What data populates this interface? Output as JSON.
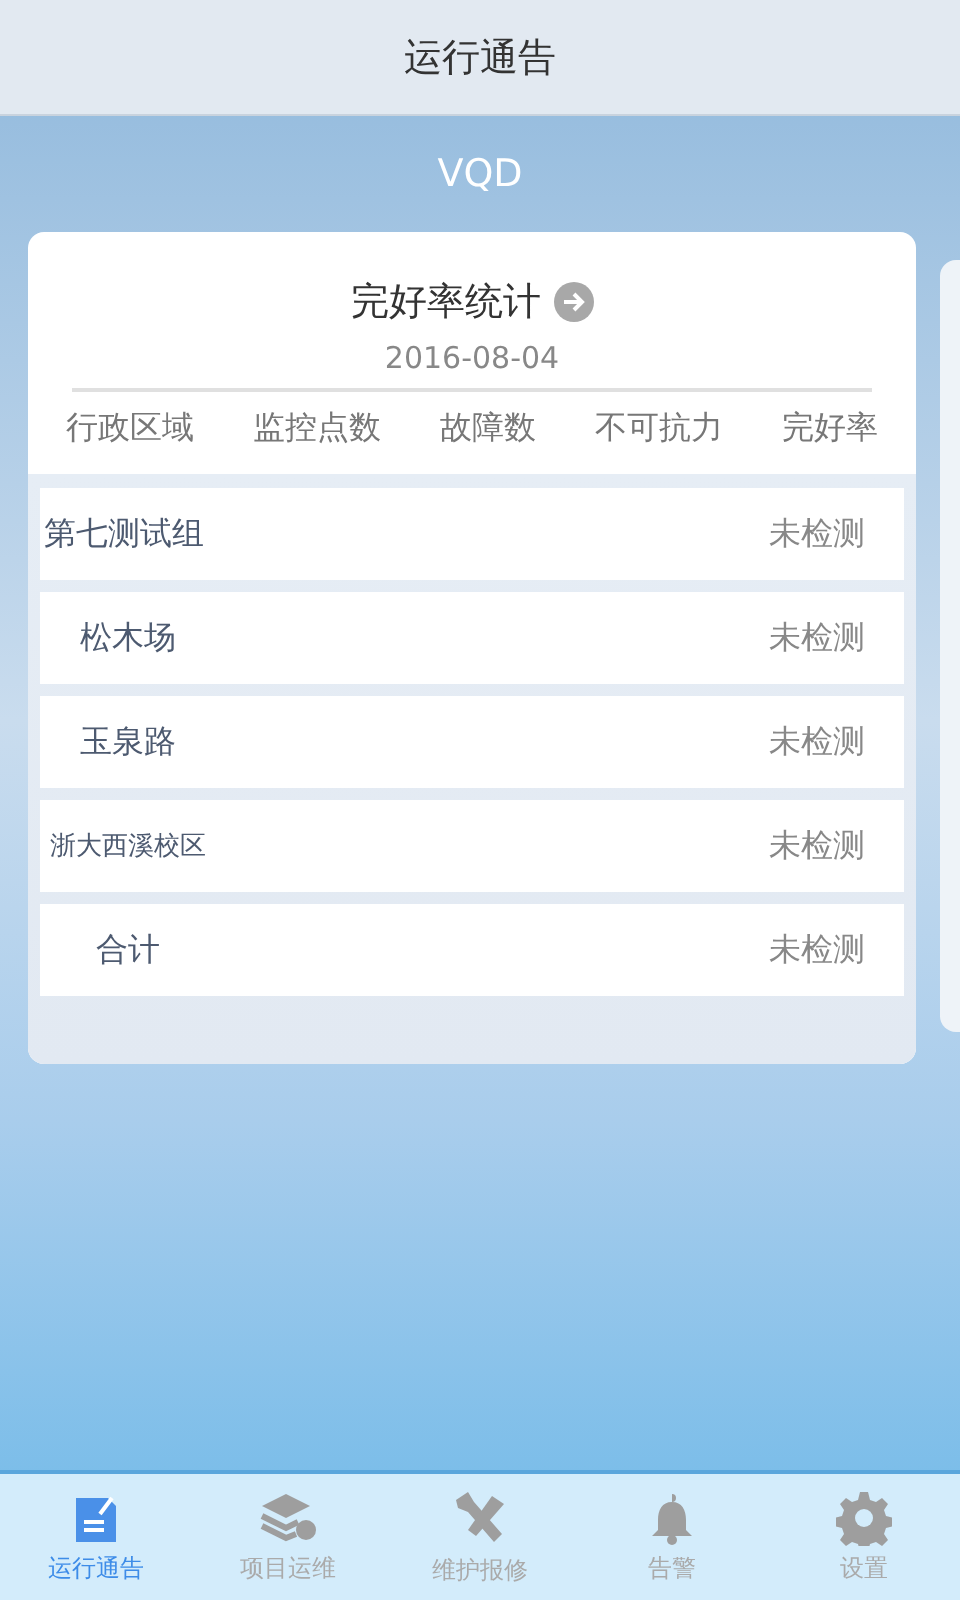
{
  "header": {
    "title": "运行通告"
  },
  "section_title": "VQD",
  "card": {
    "title": "完好率统计",
    "date": "2016-08-04",
    "columns": [
      "行政区域",
      "监控点数",
      "故障数",
      "不可抗力",
      "完好率"
    ],
    "rows": [
      {
        "name": "第七测试组",
        "rate": "未检测"
      },
      {
        "name": "松木场",
        "rate": "未检测"
      },
      {
        "name": "玉泉路",
        "rate": "未检测"
      },
      {
        "name": "浙大西溪校区",
        "rate": "未检测"
      },
      {
        "name": "合计",
        "rate": "未检测"
      }
    ]
  },
  "tabs": [
    {
      "label": "运行通告",
      "selected": true
    },
    {
      "label": "项目运维",
      "selected": false
    },
    {
      "label": "维护报修",
      "selected": false
    },
    {
      "label": "告警",
      "selected": false
    },
    {
      "label": "设置",
      "selected": false
    }
  ]
}
